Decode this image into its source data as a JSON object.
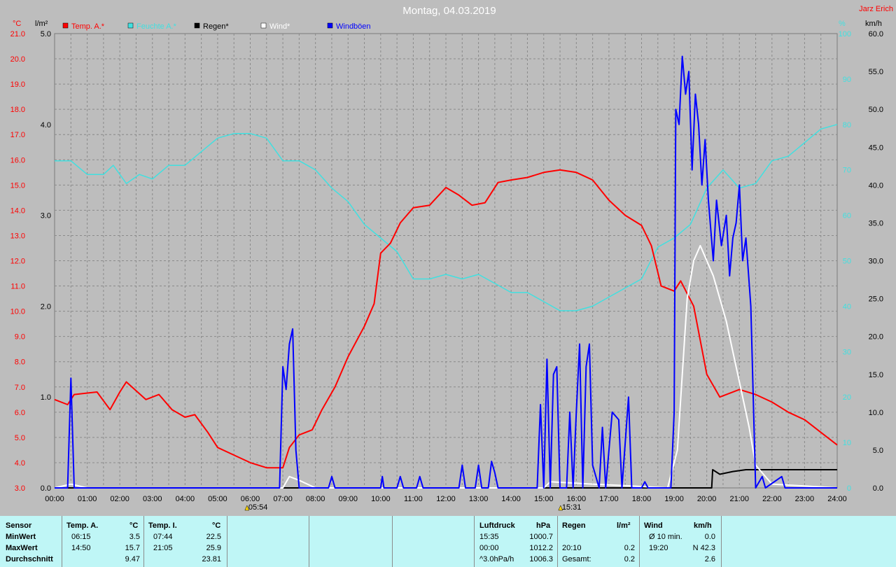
{
  "title": "Montag, 04.03.2019",
  "station": "Jarz Erich",
  "axes": {
    "left_unit_temp": "°C",
    "left_unit_rain": "l/m²",
    "right_unit_humidity": "%",
    "right_unit_wind": "km/h",
    "temp_ticks": [
      "21.0",
      "20.0",
      "19.0",
      "18.0",
      "17.0",
      "16.0",
      "15.0",
      "14.0",
      "13.0",
      "12.0",
      "11.0",
      "10.0",
      "9.0",
      "8.0",
      "7.0",
      "6.0",
      "5.0",
      "4.0",
      "3.0"
    ],
    "rain_ticks": [
      "5.0",
      "4.0",
      "3.0",
      "2.0",
      "1.0",
      "0.0"
    ],
    "humidity_ticks": [
      "100",
      "90",
      "80",
      "70",
      "60",
      "50",
      "40",
      "30",
      "20",
      "10",
      "0"
    ],
    "wind_ticks": [
      "60.0",
      "55.0",
      "50.0",
      "45.0",
      "40.0",
      "35.0",
      "30.0",
      "25.0",
      "20.0",
      "15.0",
      "10.0",
      "5.0",
      "0.0"
    ],
    "time_ticks": [
      "00:00",
      "01:00",
      "02:00",
      "03:00",
      "04:00",
      "05:00",
      "06:00",
      "07:00",
      "08:00",
      "09:00",
      "10:00",
      "11:00",
      "12:00",
      "13:00",
      "14:00",
      "15:00",
      "16:00",
      "17:00",
      "18:00",
      "19:00",
      "20:00",
      "21:00",
      "22:00",
      "23:00",
      "24:00"
    ],
    "sunrise": "05:54",
    "sunset": "15:31"
  },
  "legend": [
    {
      "label": "Temp. A.*",
      "color": "#ff0000"
    },
    {
      "label": "Feuchte A.*",
      "color": "#40e0e0"
    },
    {
      "label": "Regen*",
      "color": "#000000"
    },
    {
      "label": "Wind*",
      "color": "#ffffff"
    },
    {
      "label": "Windböen",
      "color": "#0000ff"
    }
  ],
  "chart_data": {
    "type": "line",
    "title": "Montag, 04.03.2019",
    "x_unit": "hours",
    "xlim": [
      0,
      24
    ],
    "temp_ylim": [
      3,
      21
    ],
    "rain_ylim": [
      0,
      5
    ],
    "humidity_ylim": [
      0,
      100
    ],
    "wind_ylim": [
      0,
      60
    ],
    "series": [
      {
        "name": "Temp. A.*",
        "axis": "temp",
        "color": "#ff0000",
        "points": [
          [
            0,
            6.5
          ],
          [
            0.4,
            6.3
          ],
          [
            0.6,
            6.7
          ],
          [
            1.3,
            6.8
          ],
          [
            1.7,
            6.1
          ],
          [
            2.0,
            6.8
          ],
          [
            2.2,
            7.2
          ],
          [
            2.8,
            6.5
          ],
          [
            3.2,
            6.7
          ],
          [
            3.6,
            6.1
          ],
          [
            4.0,
            5.8
          ],
          [
            4.3,
            5.9
          ],
          [
            4.7,
            5.2
          ],
          [
            5.0,
            4.6
          ],
          [
            5.5,
            4.3
          ],
          [
            6.0,
            4.0
          ],
          [
            6.5,
            3.8
          ],
          [
            7.0,
            3.8
          ],
          [
            7.2,
            4.6
          ],
          [
            7.5,
            5.1
          ],
          [
            7.9,
            5.3
          ],
          [
            8.2,
            6.1
          ],
          [
            8.6,
            7.0
          ],
          [
            9.0,
            8.2
          ],
          [
            9.5,
            9.4
          ],
          [
            9.8,
            10.3
          ],
          [
            10.0,
            12.3
          ],
          [
            10.3,
            12.7
          ],
          [
            10.6,
            13.5
          ],
          [
            11.0,
            14.1
          ],
          [
            11.5,
            14.2
          ],
          [
            12.0,
            14.9
          ],
          [
            12.4,
            14.6
          ],
          [
            12.8,
            14.2
          ],
          [
            13.2,
            14.3
          ],
          [
            13.6,
            15.1
          ],
          [
            14.0,
            15.2
          ],
          [
            14.5,
            15.3
          ],
          [
            15.0,
            15.5
          ],
          [
            15.5,
            15.6
          ],
          [
            16.0,
            15.5
          ],
          [
            16.5,
            15.2
          ],
          [
            17.0,
            14.4
          ],
          [
            17.5,
            13.8
          ],
          [
            18.0,
            13.4
          ],
          [
            18.3,
            12.6
          ],
          [
            18.6,
            11.0
          ],
          [
            19.0,
            10.8
          ],
          [
            19.2,
            11.2
          ],
          [
            19.6,
            10.2
          ],
          [
            20.0,
            7.5
          ],
          [
            20.4,
            6.6
          ],
          [
            21.0,
            6.9
          ],
          [
            21.5,
            6.7
          ],
          [
            22.0,
            6.4
          ],
          [
            22.5,
            6.0
          ],
          [
            23.0,
            5.7
          ],
          [
            23.5,
            5.2
          ],
          [
            24.0,
            4.7
          ]
        ]
      },
      {
        "name": "Feuchte A.*",
        "axis": "humidity",
        "color": "#40e0e0",
        "points": [
          [
            0,
            72
          ],
          [
            0.5,
            72
          ],
          [
            1.0,
            69
          ],
          [
            1.5,
            69
          ],
          [
            1.8,
            71
          ],
          [
            2.2,
            67
          ],
          [
            2.6,
            69
          ],
          [
            3.0,
            68
          ],
          [
            3.5,
            71
          ],
          [
            4.0,
            71
          ],
          [
            4.5,
            74
          ],
          [
            5.0,
            77
          ],
          [
            5.5,
            78
          ],
          [
            6.0,
            78
          ],
          [
            6.5,
            77
          ],
          [
            7.0,
            72
          ],
          [
            7.5,
            72
          ],
          [
            8.0,
            70
          ],
          [
            8.5,
            66
          ],
          [
            9.0,
            63
          ],
          [
            9.5,
            58
          ],
          [
            10.0,
            55
          ],
          [
            10.5,
            52
          ],
          [
            11.0,
            46
          ],
          [
            11.5,
            46
          ],
          [
            12.0,
            47
          ],
          [
            12.5,
            46
          ],
          [
            13.0,
            47
          ],
          [
            13.5,
            45
          ],
          [
            14.0,
            43
          ],
          [
            14.5,
            43
          ],
          [
            15.0,
            41
          ],
          [
            15.5,
            39
          ],
          [
            16.0,
            39
          ],
          [
            16.5,
            40
          ],
          [
            17.0,
            42
          ],
          [
            17.5,
            44
          ],
          [
            18.0,
            46
          ],
          [
            18.5,
            53
          ],
          [
            19.0,
            55
          ],
          [
            19.5,
            58
          ],
          [
            20.0,
            66
          ],
          [
            20.5,
            70
          ],
          [
            21.0,
            66
          ],
          [
            21.5,
            67
          ],
          [
            22.0,
            72
          ],
          [
            22.5,
            73
          ],
          [
            23.0,
            76
          ],
          [
            23.5,
            79
          ],
          [
            24.0,
            80
          ]
        ]
      },
      {
        "name": "Regen*",
        "axis": "rain",
        "color": "#000000",
        "points": [
          [
            0,
            0
          ],
          [
            20.15,
            0
          ],
          [
            20.18,
            0.2
          ],
          [
            20.4,
            0.15
          ],
          [
            20.8,
            0.18
          ],
          [
            21.2,
            0.2
          ],
          [
            24.0,
            0.2
          ]
        ]
      },
      {
        "name": "Wind*",
        "axis": "wind",
        "color": "#ffffff",
        "points": [
          [
            0,
            0
          ],
          [
            0.5,
            0.5
          ],
          [
            1.0,
            0
          ],
          [
            7.0,
            0
          ],
          [
            7.2,
            1.5
          ],
          [
            7.5,
            1.0
          ],
          [
            8.0,
            0
          ],
          [
            15.0,
            0
          ],
          [
            15.2,
            0.8
          ],
          [
            16.5,
            0.5
          ],
          [
            17.5,
            0.3
          ],
          [
            18.8,
            0
          ],
          [
            19.1,
            5
          ],
          [
            19.4,
            25
          ],
          [
            19.6,
            30
          ],
          [
            19.8,
            32
          ],
          [
            20.0,
            30
          ],
          [
            20.2,
            28
          ],
          [
            20.4,
            25
          ],
          [
            20.6,
            22
          ],
          [
            20.8,
            18
          ],
          [
            21.0,
            14
          ],
          [
            21.3,
            8
          ],
          [
            21.5,
            3
          ],
          [
            22.0,
            0.5
          ],
          [
            24.0,
            0
          ]
        ]
      },
      {
        "name": "Windböen",
        "axis": "wind",
        "color": "#0000ff",
        "points": [
          [
            0,
            0
          ],
          [
            0.4,
            0
          ],
          [
            0.5,
            14.5
          ],
          [
            0.6,
            0
          ],
          [
            6.9,
            0
          ],
          [
            7.0,
            16
          ],
          [
            7.1,
            13
          ],
          [
            7.2,
            19
          ],
          [
            7.3,
            21
          ],
          [
            7.4,
            5
          ],
          [
            7.5,
            0
          ],
          [
            8.4,
            0
          ],
          [
            8.5,
            1.5
          ],
          [
            8.6,
            0
          ],
          [
            10.0,
            0
          ],
          [
            10.05,
            1.5
          ],
          [
            10.1,
            0
          ],
          [
            10.5,
            0
          ],
          [
            10.6,
            1.5
          ],
          [
            10.7,
            0
          ],
          [
            11.1,
            0
          ],
          [
            11.2,
            1.5
          ],
          [
            11.3,
            0
          ],
          [
            12.4,
            0
          ],
          [
            12.5,
            3
          ],
          [
            12.6,
            0
          ],
          [
            12.9,
            0
          ],
          [
            13.0,
            3
          ],
          [
            13.1,
            0
          ],
          [
            13.3,
            0
          ],
          [
            13.4,
            3.5
          ],
          [
            13.5,
            2
          ],
          [
            13.6,
            0
          ],
          [
            14.8,
            0
          ],
          [
            14.9,
            11
          ],
          [
            15.0,
            0
          ],
          [
            15.1,
            17
          ],
          [
            15.2,
            0
          ],
          [
            15.3,
            15
          ],
          [
            15.4,
            16
          ],
          [
            15.5,
            0
          ],
          [
            15.7,
            0
          ],
          [
            15.8,
            10
          ],
          [
            15.9,
            0
          ],
          [
            16.0,
            10
          ],
          [
            16.1,
            19
          ],
          [
            16.2,
            0
          ],
          [
            16.3,
            16
          ],
          [
            16.4,
            19
          ],
          [
            16.5,
            3
          ],
          [
            16.7,
            0
          ],
          [
            16.8,
            8
          ],
          [
            16.9,
            0
          ],
          [
            17.1,
            10
          ],
          [
            17.3,
            9
          ],
          [
            17.4,
            0
          ],
          [
            17.6,
            12
          ],
          [
            17.7,
            0
          ],
          [
            18.0,
            0
          ],
          [
            18.1,
            0.8
          ],
          [
            18.2,
            0
          ],
          [
            18.9,
            0
          ],
          [
            19.0,
            10
          ],
          [
            19.05,
            50
          ],
          [
            19.15,
            48
          ],
          [
            19.25,
            57
          ],
          [
            19.35,
            52
          ],
          [
            19.45,
            55
          ],
          [
            19.55,
            42
          ],
          [
            19.65,
            52
          ],
          [
            19.75,
            48
          ],
          [
            19.85,
            40
          ],
          [
            19.95,
            46
          ],
          [
            20.05,
            38
          ],
          [
            20.2,
            30
          ],
          [
            20.3,
            38
          ],
          [
            20.45,
            32
          ],
          [
            20.6,
            36
          ],
          [
            20.7,
            28
          ],
          [
            20.8,
            33
          ],
          [
            20.9,
            35
          ],
          [
            21.0,
            40
          ],
          [
            21.1,
            30
          ],
          [
            21.2,
            33
          ],
          [
            21.35,
            24
          ],
          [
            21.45,
            8
          ],
          [
            21.5,
            0
          ],
          [
            21.7,
            1.5
          ],
          [
            21.8,
            0
          ],
          [
            22.3,
            1.5
          ],
          [
            22.4,
            0
          ],
          [
            24.0,
            0
          ]
        ]
      }
    ]
  },
  "table": {
    "headers": {
      "sensor": "Sensor",
      "temp_a": "Temp. A.",
      "temp_a_unit": "°C",
      "temp_i": "Temp. I.",
      "temp_i_unit": "°C",
      "pressure": "Luftdruck",
      "pressure_unit": "hPa",
      "rain": "Regen",
      "rain_unit": "l/m²",
      "wind": "Wind",
      "wind_unit": "km/h"
    },
    "rows": [
      {
        "label": "MinWert",
        "temp_a_time": "06:15",
        "temp_a_val": "3.5",
        "temp_i_time": "07:44",
        "temp_i_val": "22.5",
        "pressure_time": "15:35",
        "pressure_val": "1000.7",
        "rain_time": "",
        "rain_val": "",
        "wind_label": "Ø 10 min.",
        "wind_val": "0.0"
      },
      {
        "label": "MaxWert",
        "temp_a_time": "14:50",
        "temp_a_val": "15.7",
        "temp_i_time": "21:05",
        "temp_i_val": "25.9",
        "pressure_time": "00:00",
        "pressure_val": "1012.2",
        "rain_time": "20:10",
        "rain_val": "0.2",
        "wind_label": "19:20",
        "wind_val": "N 42.3"
      },
      {
        "label": "Durchschnitt",
        "temp_a_time": "",
        "temp_a_val": "9.47",
        "temp_i_time": "",
        "temp_i_val": "23.81",
        "pressure_time": "^3.0hPa/h",
        "pressure_val": "1006.3",
        "rain_time": "Gesamt:",
        "rain_val": "0.2",
        "wind_label": "",
        "wind_val": "2.6"
      }
    ]
  }
}
